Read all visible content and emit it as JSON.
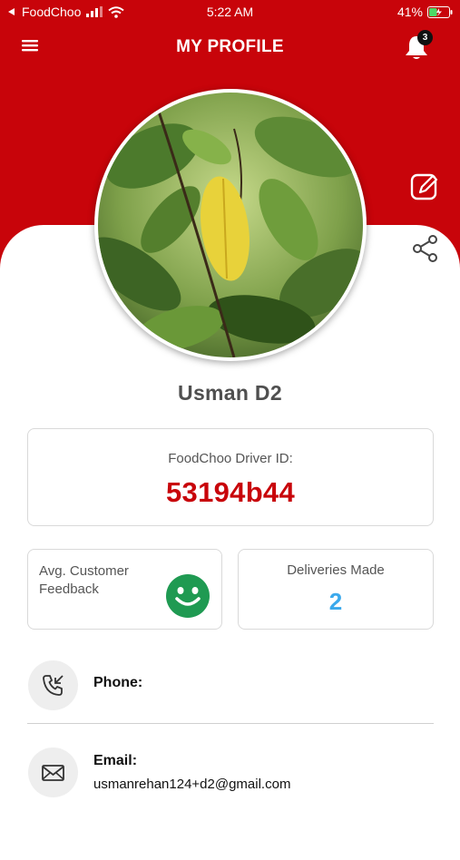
{
  "status_bar": {
    "carrier": "FoodChoo",
    "time": "5:22 AM",
    "battery_percent": "41%",
    "battery_level": 0.41
  },
  "header": {
    "title": "MY PROFILE",
    "notification_count": "3",
    "icons": {
      "menu": "hamburger-menu-icon",
      "bell": "bell-icon",
      "edit": "edit-icon",
      "share": "share-icon"
    }
  },
  "profile": {
    "name": "Usman D2",
    "driver_id_label": "FoodChoo Driver ID:",
    "driver_id": "53194b44"
  },
  "stats": {
    "feedback_label": "Avg. Customer Feedback",
    "feedback_icon": "smiley-face-icon",
    "deliveries_label": "Deliveries Made",
    "deliveries_value": "2"
  },
  "contact": {
    "phone_label": "Phone:",
    "email_label": "Email:",
    "email_value": "usmanrehan124+d2@gmail.com"
  },
  "colors": {
    "brand_red": "#c8040a",
    "smiley_green": "#1f9a52",
    "deliveries_blue": "#3ba9ec"
  }
}
